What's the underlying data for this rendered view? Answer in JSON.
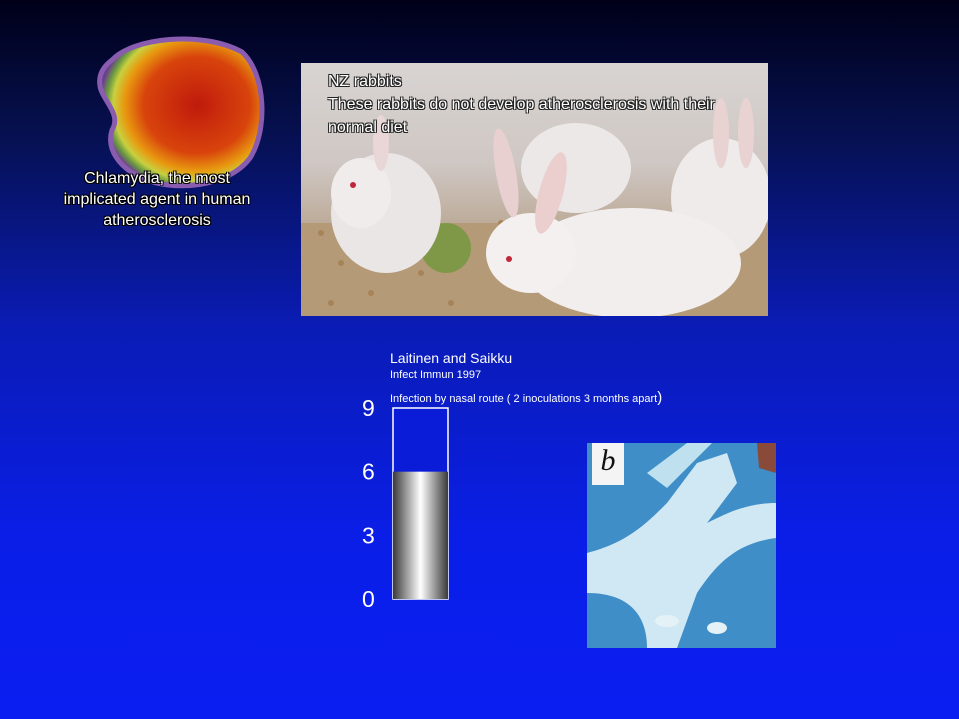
{
  "slide": {
    "chlamydia_caption": "Chlamydia, the most implicated agent in human atherosclerosis",
    "rabbit_caption_title": "NZ rabbits",
    "rabbit_caption_body": "These rabbits do not develop atherosclerosis  with their normal diet",
    "citation_authors": "Laitinen and Saikku",
    "citation_journal": "Infect Immun 1997",
    "citation_route": "Infection by nasal route   ( 2 inoculations 3 months  apart",
    "citation_route_close": ")",
    "aorta_panel_letter": "b"
  },
  "chart_data": {
    "type": "bar",
    "categories": [
      ""
    ],
    "values": [
      6
    ],
    "ylim": [
      0,
      9
    ],
    "yticks": [
      "9",
      "6",
      "3",
      "0"
    ],
    "fill": "grey-metallic gradient",
    "colors": {
      "bar_outline": "#ffffff",
      "bar_empty": "#0a1cd8"
    }
  }
}
